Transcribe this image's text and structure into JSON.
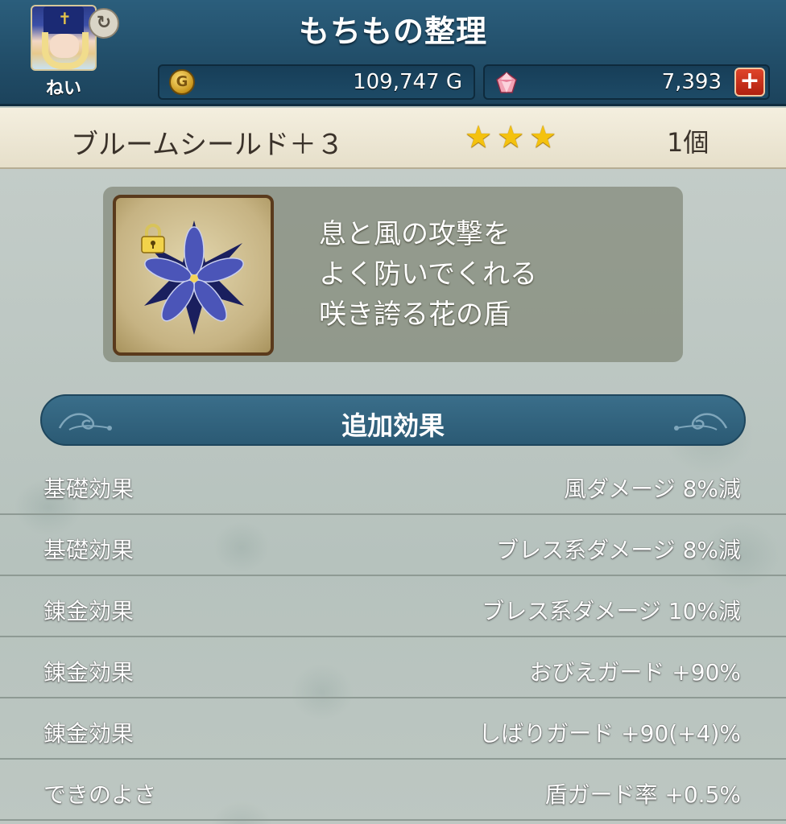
{
  "header": {
    "title": "もちもの整理",
    "player_name": "ねい",
    "gold_value": "109,747 G",
    "gem_value": "7,393",
    "plus_label": "+"
  },
  "item": {
    "name": "ブルームシールド＋３",
    "star_glyph": "★",
    "star_count": 3,
    "count": "1個",
    "description": [
      "息と風の攻撃を",
      "よく防いでくれる",
      "咲き誇る花の盾"
    ]
  },
  "effects": {
    "title": "追加効果",
    "rows": [
      {
        "label": "基礎効果",
        "value": "風ダメージ  8%減"
      },
      {
        "label": "基礎効果",
        "value": "ブレス系ダメージ  8%減"
      },
      {
        "label": "錬金効果",
        "value": "ブレス系ダメージ  10%減"
      },
      {
        "label": "錬金効果",
        "value": "おびえガード  +90%"
      },
      {
        "label": "錬金効果",
        "value": "しばりガード  +90(+4)%"
      },
      {
        "label": "できのよさ",
        "value": "盾ガード率  +0.5%"
      }
    ]
  },
  "icons": {
    "avatar": "avatar-icon",
    "swap": "swap-icon",
    "coin": "gold-coin-icon",
    "gem": "gem-icon",
    "plus": "plus-icon",
    "lock": "lock-icon",
    "shield": "bloom-shield-icon"
  },
  "colors": {
    "header_bg": "#214d68",
    "star": "#f4c20f",
    "plus_button": "#c8301a",
    "item_bar_bg": "#efe9d6"
  }
}
